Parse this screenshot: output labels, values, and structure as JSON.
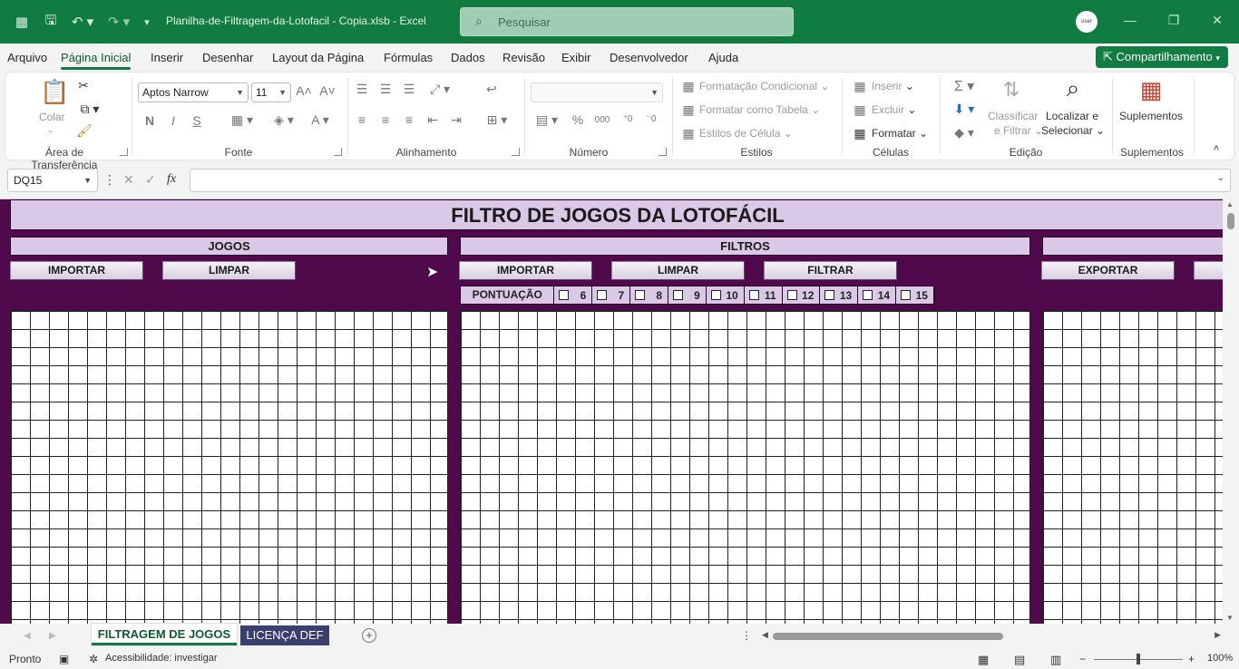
{
  "app": {
    "doc_title": "Planilha-de-Filtragem-da-Lotofacil - Copia.xlsb  -  Excel",
    "search_placeholder": "Pesquisar",
    "avatar_text": "user",
    "brand_color": "#107c41"
  },
  "menu": {
    "tabs": [
      "Arquivo",
      "Página Inicial",
      "Inserir",
      "Desenhar",
      "Layout da Página",
      "Fórmulas",
      "Dados",
      "Revisão",
      "Exibir",
      "Desenvolvedor",
      "Ajuda"
    ],
    "share_label": "Compartilhamento"
  },
  "ribbon": {
    "clipboard": {
      "label": "Área de Transferência",
      "paste": "Colar"
    },
    "font": {
      "label": "Fonte",
      "name": "Aptos Narrow",
      "size": "11",
      "bold": "N",
      "italic": "I",
      "underline": "S"
    },
    "alignment": {
      "label": "Alinhamento"
    },
    "number": {
      "label": "Número",
      "format": "",
      "percent": "%",
      "thousands": "000"
    },
    "styles": {
      "label": "Estilos",
      "conditional": "Formatação Condicional",
      "as_table": "Formatar como Tabela",
      "cell_styles": "Estilos de Célula"
    },
    "cells": {
      "label": "Células",
      "insert": "Inserir",
      "delete": "Excluir",
      "format": "Formatar"
    },
    "editing": {
      "label": "Edição",
      "sort_line1": "Classificar",
      "sort_line2": "e Filtrar",
      "find_line1": "Localizar e",
      "find_line2": "Selecionar"
    },
    "addins": {
      "label": "Suplementos",
      "button": "Suplementos"
    }
  },
  "formula_bar": {
    "name_box": "DQ15",
    "formula": ""
  },
  "sheet": {
    "title": "FILTRO DE JOGOS DA LOTOFÁCIL",
    "sections": {
      "jogos": "JOGOS",
      "filtros": "FILTROS"
    },
    "buttons": {
      "jogos_importar": "IMPORTAR",
      "jogos_limpar": "LIMPAR",
      "filtros_importar": "IMPORTAR",
      "filtros_limpar": "LIMPAR",
      "filtros_filtrar": "FILTRAR",
      "exportar": "EXPORTAR"
    },
    "pontuacao_label": "PONTUAÇÃO",
    "pontuacao_options": [
      "6",
      "7",
      "8",
      "9",
      "10",
      "11",
      "12",
      "13",
      "14",
      "15"
    ]
  },
  "sheet_tabs": [
    "FILTRAGEM DE JOGOS",
    "LICENÇA DEF"
  ],
  "status": {
    "ready": "Pronto",
    "accessibility": "Acessibilidade: investigar",
    "zoom": "100%"
  }
}
